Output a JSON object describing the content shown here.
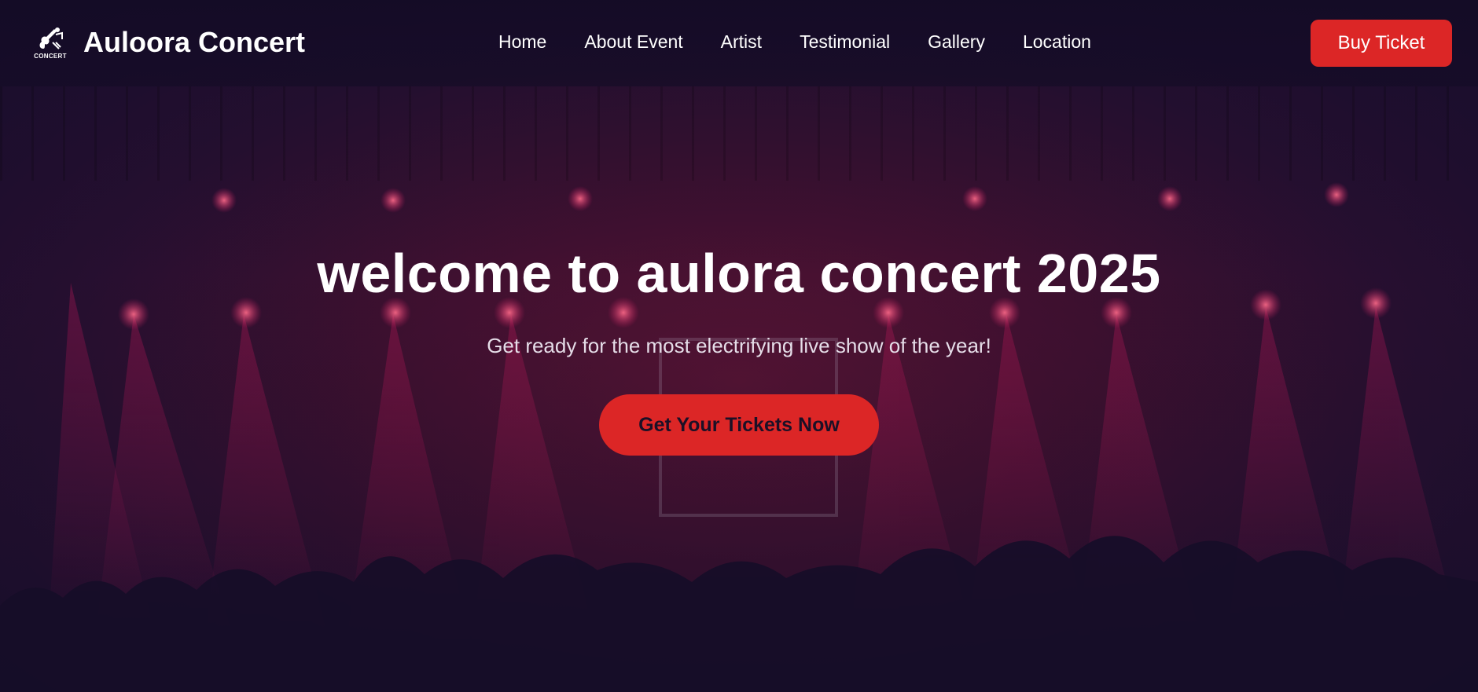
{
  "brand": {
    "logo_caption": "CONCERT",
    "name": "Auloora Concert"
  },
  "nav": {
    "items": [
      {
        "label": "Home"
      },
      {
        "label": "About Event"
      },
      {
        "label": "Artist"
      },
      {
        "label": "Testimonial"
      },
      {
        "label": "Gallery"
      },
      {
        "label": "Location"
      }
    ],
    "buy_label": "Buy Ticket"
  },
  "hero": {
    "title": "welcome to aulora concert 2025",
    "subtitle": "Get ready for the most electrifying live show of the year!",
    "cta_label": "Get Your Tickets Now"
  },
  "colors": {
    "accent": "#dc2626",
    "background": "#1a0f2e"
  },
  "icons": {
    "logo": "guitar-concert-logo-icon"
  }
}
